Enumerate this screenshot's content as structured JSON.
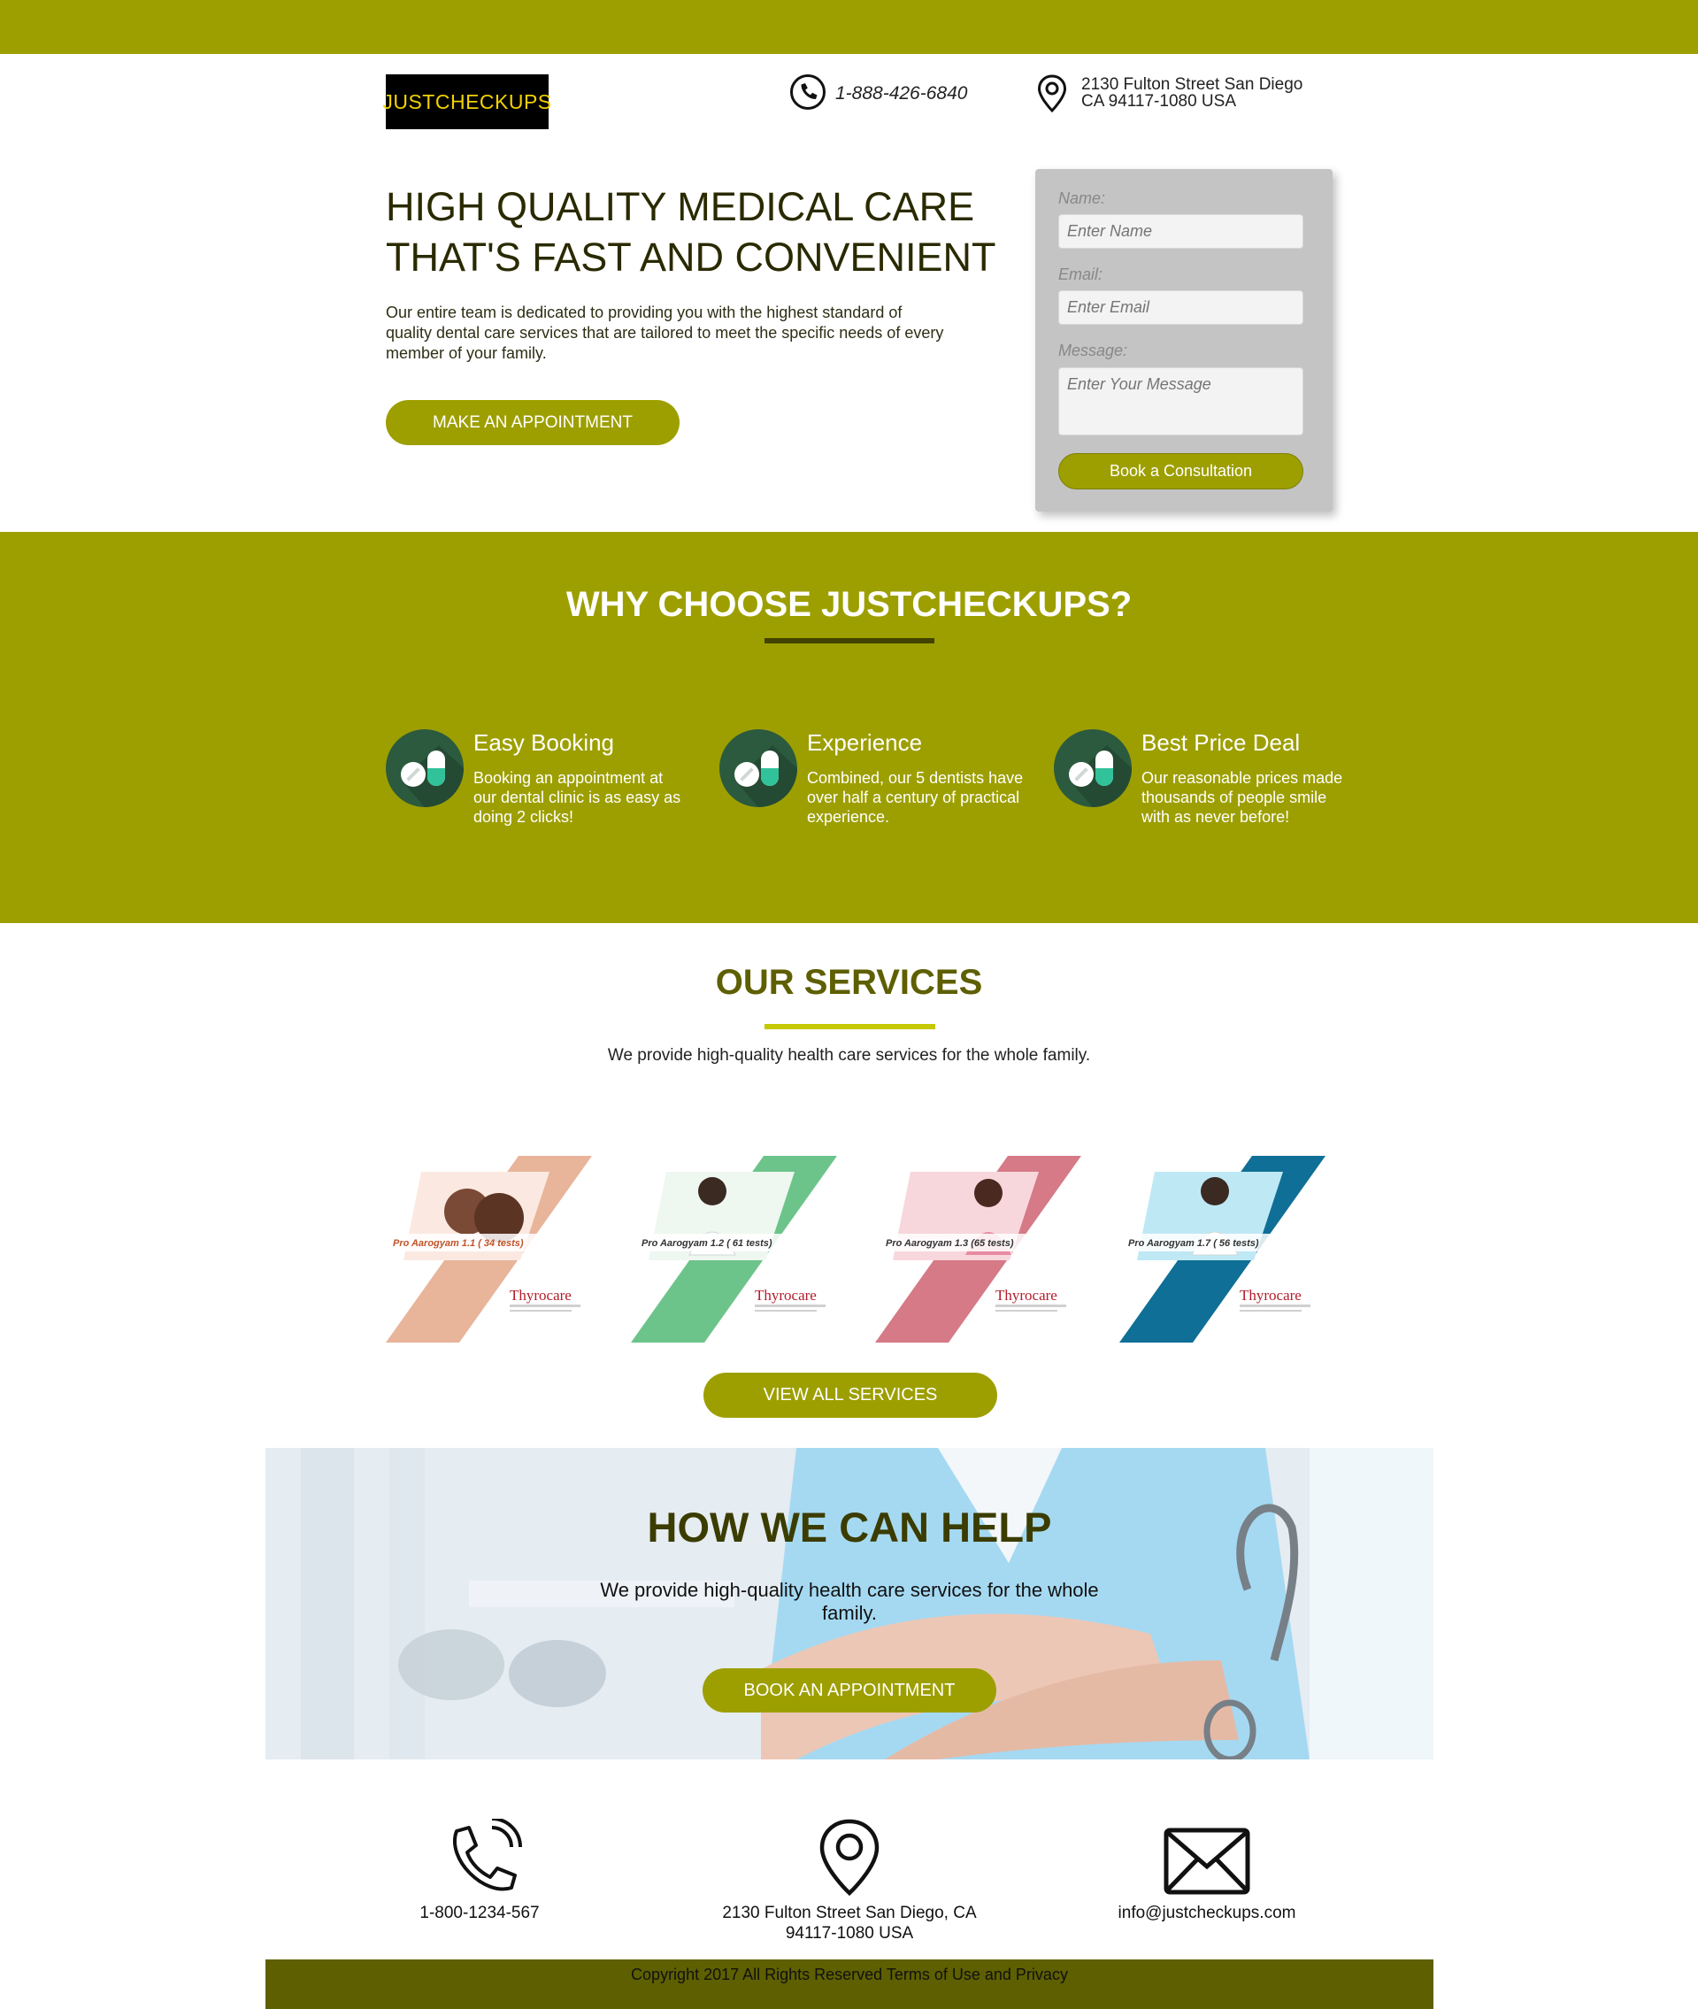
{
  "header": {
    "brand": "JUSTCHECKUPS",
    "phone": "1-888-426-6840",
    "address_line1": "2130 Fulton Street San Diego",
    "address_line2": "CA 94117-1080 USA",
    "phone_icon": "phone-icon",
    "address_icon": "map-pin-icon"
  },
  "hero": {
    "title_line1": "HIGH QUALITY MEDICAL CARE",
    "title_line2": "THAT'S FAST AND CONVENIENT",
    "text": "Our entire team is dedicated to providing you with the highest standard of quality dental care services that are tailored to meet the specific needs of every member of your family.",
    "cta": "MAKE AN APPOINTMENT"
  },
  "form": {
    "name_label": "Name:",
    "name_placeholder": "Enter Name",
    "email_label": "Email:",
    "email_placeholder": "Enter Email",
    "message_label": "Message:",
    "message_placeholder": "Enter Your Message",
    "submit": "Book a Consultation"
  },
  "why": {
    "title": "WHY CHOOSE JUSTCHECKUPS?",
    "features": [
      {
        "title": "Easy Booking",
        "text": "Booking an appointment at our dental clinic is as easy as doing 2 clicks!",
        "icon": "pills-icon"
      },
      {
        "title": "Experience",
        "text": "Combined, our 5 dentists have over half a century of practical experience.",
        "icon": "pills-icon"
      },
      {
        "title": "Best Price Deal",
        "text": "Our reasonable prices made thousands of people smile with as never before!",
        "icon": "pills-icon"
      }
    ]
  },
  "services": {
    "title": "OUR SERVICES",
    "subtitle": "We provide high-quality health care services for the whole family.",
    "cards": [
      {
        "name": "Pro Aarogyam 1.1",
        "tests": "( 34 tests)",
        "brand": "Thyrocare",
        "color": "#e8b49a"
      },
      {
        "name": "Pro Aarogyam 1.2",
        "tests": "( 61 tests)",
        "brand": "Thyrocare",
        "color": "#6cc48a"
      },
      {
        "name": "Pro Aarogyam 1.3",
        "tests": "(65 tests)",
        "brand": "Thyrocare",
        "color": "#d57a86"
      },
      {
        "name": "Pro Aarogyam 1.7",
        "tests": "( 56 tests)",
        "brand": "Thyrocare",
        "color": "#0f6f96"
      }
    ],
    "cta": "VIEW ALL SERVICES"
  },
  "help": {
    "title": "HOW WE CAN HELP",
    "text": "We provide high-quality health care services for the whole family.",
    "cta": "BOOK AN APPOINTMENT"
  },
  "contact": {
    "phone": "1-800-1234-567",
    "address_line1": "2130 Fulton Street San Diego, CA",
    "address_line2": "94117-1080 USA",
    "email": "info@justcheckups.com"
  },
  "footer": {
    "copyright": "Copyright 2017 All Rights Reserved Terms of Use and Privacy"
  },
  "colors": {
    "accent": "#9d9f00",
    "dark_accent": "#5e5f00",
    "rule_dark": "#434300",
    "rule_light": "#c6c800"
  }
}
